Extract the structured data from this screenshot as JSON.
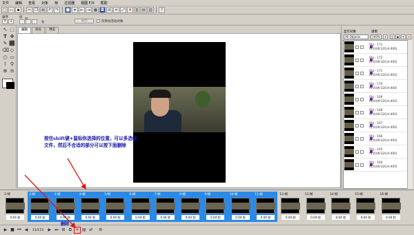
{
  "menu": [
    "文件",
    "编辑",
    "查看",
    "对象",
    "帧",
    "过滤器",
    "视图 F/X",
    "帮助"
  ],
  "row3": {
    "order_label": "顺序",
    "layers_label": "层",
    "column_label": "列",
    "left_label": "左",
    "apply_button": "属性",
    "checkbox_label": "仅移动活动对象"
  },
  "tabs": [
    "编辑",
    "优化",
    "预览"
  ],
  "annotation": "按住shift键+鼠标你选择的位置，可以多选帧文件，然后不合适的部分可以按下面删除",
  "delete_label": "删除",
  "right_panel": {
    "show_objects_label": "显示对象",
    "opacity_label": "透明",
    "select_value": "All Objects",
    "opacity_value": "100%",
    "objects": [
      {
        "name": "Obj - 173",
        "coords": "(0,0)(W:320,H:400)"
      },
      {
        "name": "Obj - 172",
        "coords": "(0,0)(W:320,H:400)"
      },
      {
        "name": "Obj - 171",
        "coords": "(0,0)(W:320,H:400)"
      },
      {
        "name": "Obj - 170",
        "coords": "(0,0)(W:320,H:400)"
      },
      {
        "name": "Obj - 169",
        "coords": "(0,0)(W:320,H:400)"
      },
      {
        "name": "Obj - 168",
        "coords": "(0,0)(W:320,H:400)"
      },
      {
        "name": "Obj - 167",
        "coords": "(0,0)(W:320,H:400)"
      },
      {
        "name": "Obj - 166",
        "coords": "(0,0)(W:320,H:400)"
      },
      {
        "name": "Obj - 165",
        "coords": "(0,0)(W:320,H:400)"
      },
      {
        "name": "Obj - 164",
        "coords": "(0,0)(W:320,H:400)"
      }
    ]
  },
  "frames": [
    {
      "label": "1:帧",
      "duration": "0.04 秒"
    },
    {
      "label": "2:帧",
      "duration": "0.04 秒"
    },
    {
      "label": "3:帧",
      "duration": "0.04 秒"
    },
    {
      "label": "4:帧",
      "duration": "0.04 秒"
    },
    {
      "label": "5:帧",
      "duration": "0.04 秒"
    },
    {
      "label": "6:帧",
      "duration": "0.04 秒"
    },
    {
      "label": "7:帧",
      "duration": "0.04 秒"
    },
    {
      "label": "8:帧",
      "duration": "0.04 秒"
    },
    {
      "label": "9:帧",
      "duration": "0.04 秒"
    },
    {
      "label": "10:帧",
      "duration": "0.04 秒"
    },
    {
      "label": "11:帧",
      "duration": "0.04 秒"
    },
    {
      "label": "12:帧",
      "duration": "0.04 秒"
    },
    {
      "label": "13:帧",
      "duration": "0.04 秒"
    },
    {
      "label": "14:帧",
      "duration": "0.04 秒"
    },
    {
      "label": "15:帧",
      "duration": "0.04 秒"
    },
    {
      "label": "16:帧",
      "duration": "0.04 秒"
    }
  ],
  "frame_counter": "11/173",
  "colors": {
    "selection": "#2b8ae8",
    "annotation": "#1515aa",
    "arrow": "#e01010",
    "highlight": "#e01010"
  },
  "icons": {
    "toolbar": [
      "new-icon",
      "open-icon",
      "save-icon",
      "cut-icon",
      "copy-icon",
      "paste-icon",
      "undo-icon",
      "redo-icon",
      "crop-icon",
      "resize-icon",
      "delete-icon",
      "help-icon"
    ]
  }
}
